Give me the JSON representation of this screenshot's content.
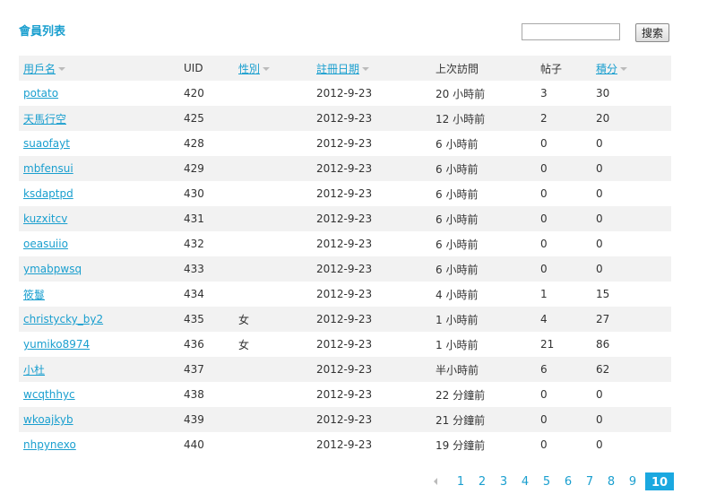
{
  "page_title": "會員列表",
  "search": {
    "button_label": "搜索",
    "value": ""
  },
  "table": {
    "columns": [
      {
        "key": "username",
        "label": "用戶名",
        "link": true,
        "sortable": true
      },
      {
        "key": "uid",
        "label": "UID",
        "link": false,
        "sortable": false
      },
      {
        "key": "gender",
        "label": "性別",
        "link": true,
        "sortable": true
      },
      {
        "key": "reg_date",
        "label": "註冊日期",
        "link": true,
        "sortable": true
      },
      {
        "key": "last_visit",
        "label": "上次訪問",
        "link": false,
        "sortable": false
      },
      {
        "key": "posts",
        "label": "帖子",
        "link": false,
        "sortable": false
      },
      {
        "key": "points",
        "label": "積分",
        "link": true,
        "sortable": true
      }
    ],
    "rows": [
      {
        "username": "potato",
        "uid": "420",
        "gender": "",
        "reg_date": "2012-9-23",
        "last_visit": "20 小時前",
        "posts": "3",
        "points": "30"
      },
      {
        "username": "天馬行空",
        "uid": "425",
        "gender": "",
        "reg_date": "2012-9-23",
        "last_visit": "12 小時前",
        "posts": "2",
        "points": "20"
      },
      {
        "username": "suaofayt",
        "uid": "428",
        "gender": "",
        "reg_date": "2012-9-23",
        "last_visit": "6 小時前",
        "posts": "0",
        "points": "0"
      },
      {
        "username": "mbfensui",
        "uid": "429",
        "gender": "",
        "reg_date": "2012-9-23",
        "last_visit": "6 小時前",
        "posts": "0",
        "points": "0"
      },
      {
        "username": "ksdaptpd",
        "uid": "430",
        "gender": "",
        "reg_date": "2012-9-23",
        "last_visit": "6 小時前",
        "posts": "0",
        "points": "0"
      },
      {
        "username": "kuzxitcv",
        "uid": "431",
        "gender": "",
        "reg_date": "2012-9-23",
        "last_visit": "6 小時前",
        "posts": "0",
        "points": "0"
      },
      {
        "username": "oeasuiio",
        "uid": "432",
        "gender": "",
        "reg_date": "2012-9-23",
        "last_visit": "6 小時前",
        "posts": "0",
        "points": "0"
      },
      {
        "username": "ymabpwsq",
        "uid": "433",
        "gender": "",
        "reg_date": "2012-9-23",
        "last_visit": "6 小時前",
        "posts": "0",
        "points": "0"
      },
      {
        "username": "筱鬘",
        "uid": "434",
        "gender": "",
        "reg_date": "2012-9-23",
        "last_visit": "4 小時前",
        "posts": "1",
        "points": "15"
      },
      {
        "username": "christycky_by2",
        "uid": "435",
        "gender": "女",
        "reg_date": "2012-9-23",
        "last_visit": "1 小時前",
        "posts": "4",
        "points": "27"
      },
      {
        "username": "yumiko8974",
        "uid": "436",
        "gender": "女",
        "reg_date": "2012-9-23",
        "last_visit": "1 小時前",
        "posts": "21",
        "points": "86"
      },
      {
        "username": "小杜",
        "uid": "437",
        "gender": "",
        "reg_date": "2012-9-23",
        "last_visit": "半小時前",
        "posts": "6",
        "points": "62"
      },
      {
        "username": "wcqthhyc",
        "uid": "438",
        "gender": "",
        "reg_date": "2012-9-23",
        "last_visit": "22 分鐘前",
        "posts": "0",
        "points": "0"
      },
      {
        "username": "wkoajkyb",
        "uid": "439",
        "gender": "",
        "reg_date": "2012-9-23",
        "last_visit": "21 分鐘前",
        "posts": "0",
        "points": "0"
      },
      {
        "username": "nhpynexo",
        "uid": "440",
        "gender": "",
        "reg_date": "2012-9-23",
        "last_visit": "19 分鐘前",
        "posts": "0",
        "points": "0"
      }
    ]
  },
  "pagination": {
    "pages": [
      "1",
      "2",
      "3",
      "4",
      "5",
      "6",
      "7",
      "8",
      "9",
      "10"
    ],
    "current": "10"
  },
  "colors": {
    "link": "#1a9fcf",
    "current_page_bg": "#1aa8e0",
    "stripe": "#f2f2f2"
  }
}
